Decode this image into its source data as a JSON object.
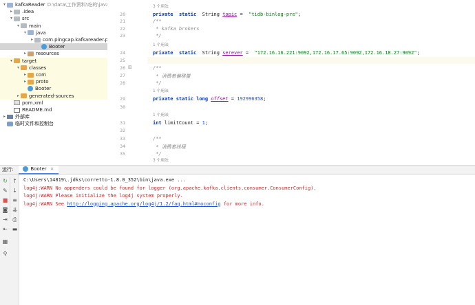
{
  "tree": {
    "items": [
      {
        "label": "kafkaReader",
        "path": "D:\\data\\工作资料\\吃的\\java\\kafkaRe",
        "level": 0,
        "expanded": true,
        "icon": "folder-blue"
      },
      {
        "label": ".idea",
        "level": 1,
        "expanded": false,
        "icon": "folder-gray"
      },
      {
        "label": "src",
        "level": 1,
        "expanded": true,
        "icon": "folder-gray"
      },
      {
        "label": "main",
        "level": 2,
        "expanded": true,
        "icon": "folder-gray"
      },
      {
        "label": "java",
        "level": 3,
        "expanded": true,
        "icon": "folder-blue"
      },
      {
        "label": "com.pingcap.kafkareader.proto",
        "level": 4,
        "expanded": false,
        "icon": "folder-gray"
      },
      {
        "label": "Booter",
        "level": 5,
        "icon": "class-icon",
        "selected": true
      },
      {
        "label": "resources",
        "level": 3,
        "expanded": false,
        "icon": "folder-brown"
      },
      {
        "label": "target",
        "level": 1,
        "expanded": true,
        "icon": "folder-orange",
        "highlight": true
      },
      {
        "label": "classes",
        "level": 2,
        "expanded": true,
        "icon": "folder-orange",
        "highlight": true
      },
      {
        "label": "com",
        "level": 3,
        "expanded": false,
        "icon": "folder-orange",
        "highlight": true
      },
      {
        "label": "proto",
        "level": 3,
        "expanded": false,
        "icon": "folder-orange",
        "highlight": true
      },
      {
        "label": "Booter",
        "level": 3,
        "icon": "class-icon",
        "highlight": true
      },
      {
        "label": "generated-sources",
        "level": 2,
        "expanded": false,
        "icon": "folder-orange",
        "highlight": true
      },
      {
        "label": "pom.xml",
        "level": 1,
        "icon": "pom-icon"
      },
      {
        "label": "README.md",
        "level": 1,
        "icon": "md-icon"
      },
      {
        "label": "外部库",
        "level": 0,
        "expanded": false,
        "icon": "lib-icon"
      },
      {
        "label": "临时文件和控制台",
        "level": 0,
        "icon": "scratch-icon"
      }
    ]
  },
  "editor": {
    "usage_hint": "1 个用法",
    "usage_hint_3": "3 个用法",
    "lines": [
      {
        "num": "20",
        "kind": "code",
        "tokens": [
          [
            "kw",
            "private"
          ],
          [
            "t",
            "  "
          ],
          [
            "kw",
            "static"
          ],
          [
            "t",
            "  String "
          ],
          [
            "field",
            "topic"
          ],
          [
            "t",
            " =  "
          ],
          [
            "str",
            "\"tidb-binlog-pre\""
          ],
          [
            "t",
            ";"
          ]
        ]
      },
      {
        "num": "21",
        "kind": "code",
        "tokens": [
          [
            "comment",
            "/**"
          ]
        ]
      },
      {
        "num": "22",
        "kind": "code",
        "tokens": [
          [
            "comment",
            " * kafka brokers"
          ]
        ]
      },
      {
        "num": "23",
        "kind": "code",
        "tokens": [
          [
            "comment",
            " */"
          ]
        ]
      },
      {
        "num": "24",
        "kind": "code",
        "tokens": [
          [
            "kw",
            "private"
          ],
          [
            "t",
            "  "
          ],
          [
            "kw",
            "static"
          ],
          [
            "t",
            "  String "
          ],
          [
            "field",
            "serever"
          ],
          [
            "t",
            " =  "
          ],
          [
            "str",
            "\"172.16.16.221:9092,172.16.17.65:9092,172.16.18.27:9092\""
          ],
          [
            "t",
            ";"
          ]
        ]
      },
      {
        "num": "25",
        "kind": "code",
        "tokens": []
      },
      {
        "num": "26",
        "kind": "code",
        "tokens": [
          [
            "comment",
            "/**"
          ]
        ]
      },
      {
        "num": "27",
        "kind": "code",
        "tokens": [
          [
            "comment",
            " * 消费者偏移量"
          ]
        ]
      },
      {
        "num": "28",
        "kind": "code",
        "tokens": [
          [
            "comment",
            " */"
          ]
        ]
      },
      {
        "num": "29",
        "kind": "code",
        "tokens": [
          [
            "kw",
            "private static long "
          ],
          [
            "field-italic",
            "offset"
          ],
          [
            "t",
            " = "
          ],
          [
            "num",
            "192996358"
          ],
          [
            "t",
            ";"
          ]
        ]
      },
      {
        "num": "30",
        "kind": "code",
        "tokens": []
      },
      {
        "num": "31",
        "kind": "code",
        "tokens": [
          [
            "kw",
            "int "
          ],
          [
            "t",
            "limitCount = "
          ],
          [
            "num",
            "1"
          ],
          [
            "t",
            ";"
          ]
        ]
      },
      {
        "num": "32",
        "kind": "code",
        "tokens": []
      },
      {
        "num": "33",
        "kind": "code",
        "tokens": [
          [
            "comment",
            "/**"
          ]
        ]
      },
      {
        "num": "34",
        "kind": "code",
        "tokens": [
          [
            "comment",
            " * 消费者线程"
          ]
        ]
      },
      {
        "num": "35",
        "kind": "code",
        "tokens": [
          [
            "comment",
            " */"
          ]
        ]
      }
    ]
  },
  "run": {
    "label": "运行:",
    "tab_title": "Booter",
    "tab_close": "×",
    "console_lines": [
      {
        "type": "cmd",
        "text": "C:\\Users\\14819\\.jdks\\corretto-1.8.0_352\\bin\\java.exe ..."
      },
      {
        "type": "err",
        "text": "log4j:WARN No appenders could be found for logger (org.apache.kafka.clients.consumer.ConsumerConfig)."
      },
      {
        "type": "err",
        "text": "log4j:WARN Please initialize the log4j system properly."
      },
      {
        "type": "link",
        "prefix": "log4j:WARN See ",
        "link": "http://logging.apache.org/log4j/1.2/faq.html#noconfig",
        "suffix": " for more info."
      }
    ]
  }
}
